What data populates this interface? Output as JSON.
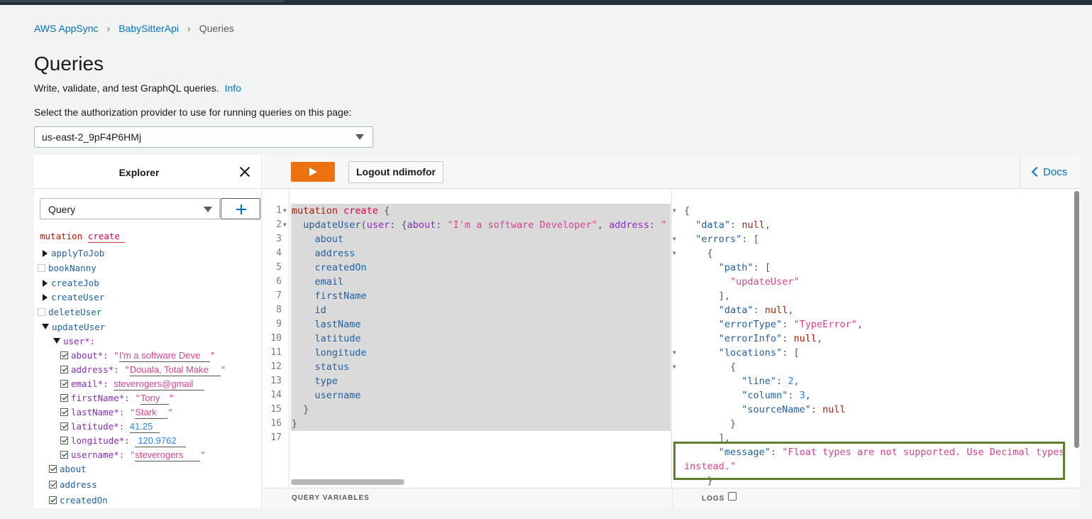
{
  "breadcrumb": {
    "root": "AWS AppSync",
    "api": "BabySitterApi",
    "current": "Queries"
  },
  "page": {
    "title": "Queries",
    "description": "Write, validate, and test GraphQL queries.",
    "info_link": "Info",
    "auth_label": "Select the authorization provider to use for running queries on this page:",
    "auth_value": "us-east-2_9pF4P6HMj"
  },
  "explorer": {
    "title": "Explorer",
    "operation_type": "Query",
    "mutation_keyword": "mutation",
    "operation_name": "create",
    "fields": {
      "applyToJob": "applyToJob",
      "bookNanny": "bookNanny",
      "createJob": "createJob",
      "createUser": "createUser",
      "deleteUser": "deleteUser",
      "updateUser": "updateUser",
      "user_arg": "user*:"
    },
    "args": [
      {
        "name": "about*:",
        "value": "I'm a software Deve",
        "kind": "string"
      },
      {
        "name": "address*:",
        "value": " Douala, Total Make",
        "kind": "string"
      },
      {
        "name": "email*:",
        "value": "steverogers@gmail",
        "kind": "string"
      },
      {
        "name": "firstName*:",
        "value": "Tony ",
        "kind": "string"
      },
      {
        "name": "lastName*:",
        "value": "Stark  ",
        "kind": "string"
      },
      {
        "name": "latitude*:",
        "value": "41.25",
        "kind": "number"
      },
      {
        "name": "longitude*:",
        "value": "120.9762",
        "kind": "number"
      },
      {
        "name": "username*:",
        "value": "steverogers    ",
        "kind": "string"
      }
    ],
    "selected_fields": [
      "about",
      "address",
      "createdOn"
    ]
  },
  "toolbar": {
    "logout_label": "Logout ndimofor",
    "docs_label": "Docs"
  },
  "editor": {
    "line_numbers": [
      "1",
      "2",
      "3",
      "4",
      "5",
      "6",
      "7",
      "8",
      "9",
      "10",
      "11",
      "12",
      "13",
      "14",
      "15",
      "16",
      "17"
    ],
    "l1_kw": "mutation",
    "l1_name": "create",
    "l1_punc": " {",
    "l2_field": "updateUser",
    "l2_arg": "user",
    "l2_key1": "about",
    "l2_val1": "\"I'm a software Developer\"",
    "l2_key2": "address",
    "l2_val2": "\" Douala, Total Makepe\"",
    "fields": [
      "about",
      "address",
      "createdOn",
      "email",
      "firstName",
      "id",
      "lastName",
      "latitude",
      "longitude",
      "status",
      "type",
      "username"
    ],
    "close_inner": "}",
    "close_outer": "}"
  },
  "result": {
    "k_data": "\"data\"",
    "k_errors": "\"errors\"",
    "k_path": "\"path\"",
    "v_path0": "\"updateUser\"",
    "k_errorType": "\"errorType\"",
    "v_errorType": "\"TypeError\"",
    "k_errorInfo": "\"errorInfo\"",
    "k_locations": "\"locations\"",
    "k_line": "\"line\"",
    "v_line": "2",
    "k_column": "\"column\"",
    "v_column": "3",
    "k_sourceName": "\"sourceName\"",
    "k_message": "\"message\"",
    "v_message_1": "\"Float types are not supported. Use Decimal types",
    "v_message_2": "instead.\"",
    "null": "null"
  },
  "bottom": {
    "query_variables": "QUERY VARIABLES",
    "logs": "LOGS"
  }
}
